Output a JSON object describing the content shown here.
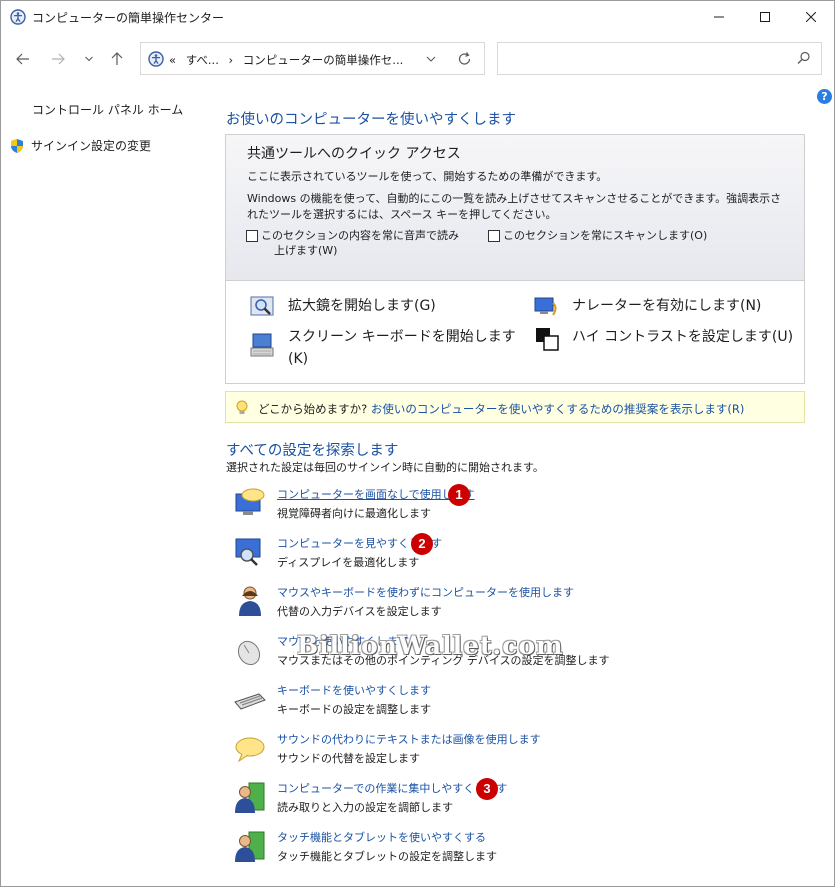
{
  "window": {
    "title": "コンピューターの簡単操作センター"
  },
  "address": {
    "prefix": "«",
    "crumbs": [
      "すべ...",
      "›",
      "コンピューターの簡単操作セ..."
    ]
  },
  "search": {
    "placeholder": ""
  },
  "help": "?",
  "sidebar": {
    "home": "コントロール パネル ホーム",
    "signin": "サインイン設定の変更"
  },
  "main": {
    "title": "お使いのコンピューターを使いやすくします",
    "quick": {
      "title": "共通ツールへのクイック アクセス",
      "desc1": "ここに表示されているツールを使って、開始するための準備ができます。",
      "desc2": "Windows の機能を使って、自動的にこの一覧を読み上げさせてスキャンさせることができます。強調表示されたツールを選択するには、スペース キーを押してください。",
      "check_read_line1": "このセクションの内容を常に音声で読み",
      "check_read_line2": "上げます(W)",
      "check_scan": "このセクションを常にスキャンします(O)",
      "tools": {
        "magnifier": "拡大鏡を開始します(G)",
        "narrator": "ナレーターを有効にします(N)",
        "osk_line1": "スクリーン キーボードを開始します",
        "osk_line2": "(K)",
        "contrast": "ハイ コントラストを設定します(U)"
      }
    },
    "tip": {
      "question": "どこから始めますか?",
      "link": "お使いのコンピューターを使いやすくするための推奨案を表示します(R)"
    },
    "explore": {
      "title": "すべての設定を探索します",
      "subtitle": "選択された設定は毎回のサインイン時に自動的に開始されます。",
      "items": [
        {
          "link": "コンピューターを画面なしで使用します",
          "desc": "視覚障碍者向けに最適化します"
        },
        {
          "link": "コンピューターを見やすくします",
          "desc": "ディスプレイを最適化します"
        },
        {
          "link": "マウスやキーボードを使わずにコンピューターを使用します",
          "desc": "代替の入力デバイスを設定します"
        },
        {
          "link": "マウスを使いやすくします",
          "desc": "マウスまたはその他のポインティング デバイスの設定を調整します"
        },
        {
          "link": "キーボードを使いやすくします",
          "desc": "キーボードの設定を調整します"
        },
        {
          "link": "サウンドの代わりにテキストまたは画像を使用します",
          "desc": "サウンドの代替を設定します"
        },
        {
          "link": "コンピューターでの作業に集中しやすくします",
          "desc": "読み取りと入力の設定を調節します"
        },
        {
          "link": "タッチ機能とタブレットを使いやすくする",
          "desc": "タッチ機能とタブレットの設定を調整します"
        }
      ]
    }
  },
  "annotations": [
    "1",
    "2",
    "3"
  ],
  "watermark": "BillionWallet.com",
  "colors": {
    "link": "#1a52a4",
    "badge": "#cc0000",
    "tip_bg": "#ffffe1"
  }
}
